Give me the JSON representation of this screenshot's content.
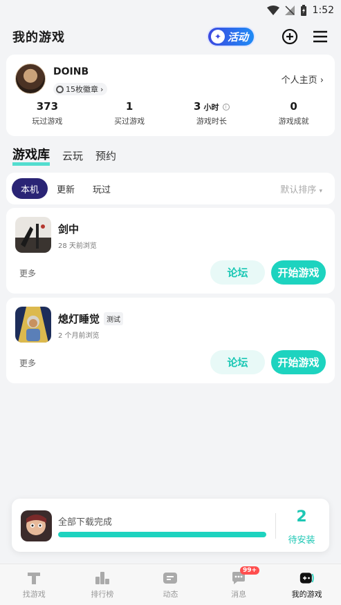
{
  "status_bar": {
    "time": "1:52"
  },
  "header": {
    "title": "我的游戏",
    "activity_label": "活动"
  },
  "profile": {
    "username": "DOINB",
    "medal_text": "15枚徽章",
    "homepage_label": "个人主页",
    "stats": [
      {
        "value": "373",
        "unit": "",
        "label": "玩过游戏"
      },
      {
        "value": "1",
        "unit": "",
        "label": "买过游戏"
      },
      {
        "value": "3",
        "unit": "小时",
        "label": "游戏时长"
      },
      {
        "value": "0",
        "unit": "",
        "label": "游戏成就"
      }
    ]
  },
  "tabs": [
    "游戏库",
    "云玩",
    "预约"
  ],
  "filters": {
    "items": [
      "本机",
      "更新",
      "玩过"
    ],
    "sort_label": "默认排序"
  },
  "games": [
    {
      "name": "剑中",
      "tag": "",
      "last_viewed": "28 天前浏览",
      "more": "更多",
      "forum": "论坛",
      "start": "开始游戏"
    },
    {
      "name": "熄灯睡觉",
      "tag": "测试",
      "last_viewed": "2 个月前浏览",
      "more": "更多",
      "forum": "论坛",
      "start": "开始游戏"
    }
  ],
  "download": {
    "status": "全部下载完成",
    "progress": 1.0,
    "count": "2",
    "count_label": "待安装"
  },
  "bottom_nav": [
    {
      "label": "找游戏",
      "icon": "discover-icon"
    },
    {
      "label": "排行榜",
      "icon": "leaderboard-icon"
    },
    {
      "label": "动态",
      "icon": "feed-icon"
    },
    {
      "label": "消息",
      "icon": "message-icon",
      "badge": "99+"
    },
    {
      "label": "我的游戏",
      "icon": "gamepad-icon"
    }
  ],
  "colors": {
    "accent": "#1dd3bf",
    "chip_active": "#2a2475",
    "badge": "#ff4e4e"
  }
}
